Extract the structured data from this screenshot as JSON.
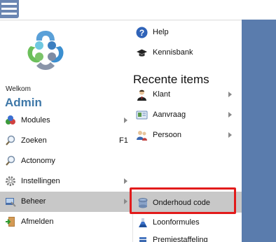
{
  "user": {
    "welcome": "Welkom",
    "name": "Admin"
  },
  "left_menu": [
    {
      "id": "modules",
      "label": "Modules",
      "icon": "modules-icon",
      "has_submenu": true,
      "shortcut": ""
    },
    {
      "id": "zoeken",
      "label": "Zoeken",
      "icon": "search-icon",
      "has_submenu": false,
      "shortcut": "F1"
    },
    {
      "id": "actonomy",
      "label": "Actonomy",
      "icon": "search-icon",
      "has_submenu": false,
      "shortcut": ""
    },
    {
      "id": "instellingen",
      "label": "Instellingen",
      "icon": "gear-icon",
      "has_submenu": true,
      "shortcut": ""
    },
    {
      "id": "beheer",
      "label": "Beheer",
      "icon": "admin-tools-icon",
      "has_submenu": true,
      "shortcut": "",
      "active": true
    },
    {
      "id": "afmelden",
      "label": "Afmelden",
      "icon": "logout-door-icon",
      "has_submenu": false,
      "shortcut": ""
    }
  ],
  "right_top": [
    {
      "id": "help",
      "label": "Help",
      "icon": "help-icon"
    },
    {
      "id": "kennisbank",
      "label": "Kennisbank",
      "icon": "graduation-cap-icon"
    }
  ],
  "recent": {
    "title": "Recente items",
    "items": [
      {
        "id": "klant",
        "label": "Klant",
        "icon": "person-icon"
      },
      {
        "id": "aanvraag",
        "label": "Aanvraag",
        "icon": "id-card-icon"
      },
      {
        "id": "persoon",
        "label": "Persoon",
        "icon": "people-icon"
      }
    ]
  },
  "beheer_submenu": [
    {
      "id": "onderhoud-code",
      "label": "Onderhoud code",
      "icon": "database-icon",
      "highlighted": true
    },
    {
      "id": "loonformules",
      "label": "Loonformules",
      "icon": "flask-icon"
    },
    {
      "id": "premiestaffeling",
      "label": "Premiestaffeling",
      "icon": "stack-icon"
    }
  ],
  "colors": {
    "accent": "#3f78a8",
    "background_panel": "#5a7cad",
    "active_row": "#c8c8c8",
    "highlight_border": "#e21b1b"
  }
}
